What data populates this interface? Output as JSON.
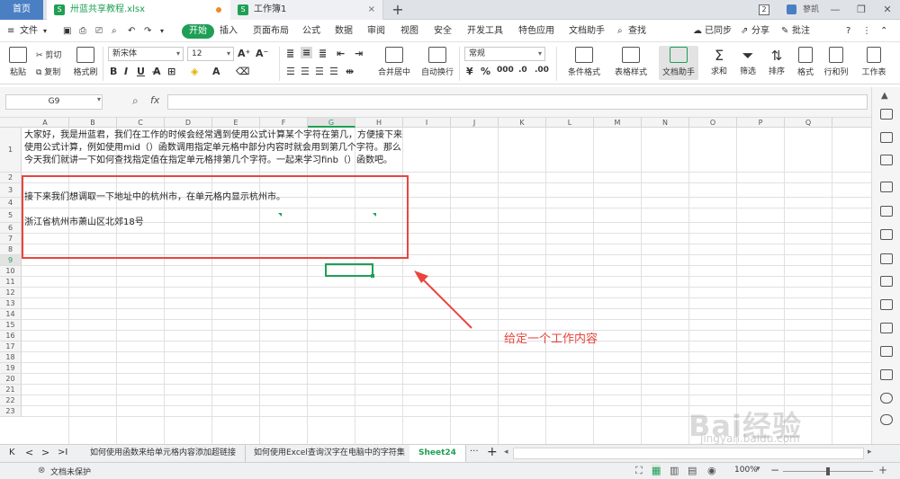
{
  "tabs": {
    "home": "首页",
    "file1": "卅蓝共享教程.xlsx",
    "file2": "工作簿1",
    "new_tab": "+"
  },
  "titlebar_right": {
    "badge": "2",
    "user": "蓼凯"
  },
  "menu": {
    "file": "文件",
    "items": [
      "开始",
      "插入",
      "页面布局",
      "公式",
      "数据",
      "审阅",
      "视图",
      "安全",
      "开发工具",
      "特色应用",
      "文档助手"
    ],
    "search": "查找",
    "sync": "已同步",
    "share": "分享",
    "comment": "批注"
  },
  "ribbon": {
    "paste": "粘贴",
    "cut": "剪切",
    "copy": "复制",
    "format_painter": "格式刷",
    "font_name": "新宋体",
    "font_size": "12",
    "bold": "B",
    "italic": "I",
    "underline": "U",
    "merge_center": "合并居中",
    "wrap_text": "自动换行",
    "number_format": "常规",
    "conditional_format": "条件格式",
    "table_style": "表格样式",
    "doc_assistant": "文档助手",
    "sum": "求和",
    "filter": "筛选",
    "sort": "排序",
    "format": "格式",
    "rows_cols": "行和列",
    "worksheet": "工作表"
  },
  "formula_bar": {
    "name_box": "G9",
    "fx": "fx",
    "value": ""
  },
  "columns": [
    "A",
    "B",
    "C",
    "D",
    "E",
    "F",
    "G",
    "H",
    "I",
    "J",
    "K",
    "L",
    "M",
    "N",
    "O",
    "P",
    "Q"
  ],
  "active_column": "G",
  "active_row": "9",
  "rows": [
    "1",
    "2",
    "3",
    "4",
    "5",
    "6",
    "7",
    "8",
    "9",
    "10",
    "11",
    "12",
    "13",
    "14",
    "15",
    "16",
    "17",
    "18",
    "19",
    "20",
    "21",
    "22",
    "23"
  ],
  "cells": {
    "a1_line1": "大家好，我是卅蓝君，我们在工作的时候会经常遇到使用公式计算某个字符在第几，方便接下来",
    "a1_line2": "使用公式计算，例如使用mid（）函数调用指定单元格中部分内容时就会用到第几个字符。那么",
    "a1_line3": "今天我们就讲一下如何查找指定值在指定单元格排第几个字符。一起来学习finb（）函数吧。",
    "a3": "接下来我们想调取一下地址中的杭州市，在单元格内显示杭州市。",
    "a5": "浙江省杭州市萧山区北郊18号"
  },
  "annotation": {
    "label": "给定一个工作内容",
    "color": "#e8453c"
  },
  "sheet_tabs": {
    "tab1": "如何使用函数来给单元格内容添加超链接",
    "tab2": "如何使用Excel查询汉字在电脑中的字符集",
    "active": "Sheet24",
    "more": "···",
    "add": "+"
  },
  "status": {
    "protect": "文档未保护",
    "zoom": "100%"
  },
  "watermark": {
    "brand": "Bai经验",
    "url": "jingyan.baidu.com"
  },
  "colors": {
    "accent": "#1e9f55",
    "tab_blue": "#4a7fc4"
  }
}
